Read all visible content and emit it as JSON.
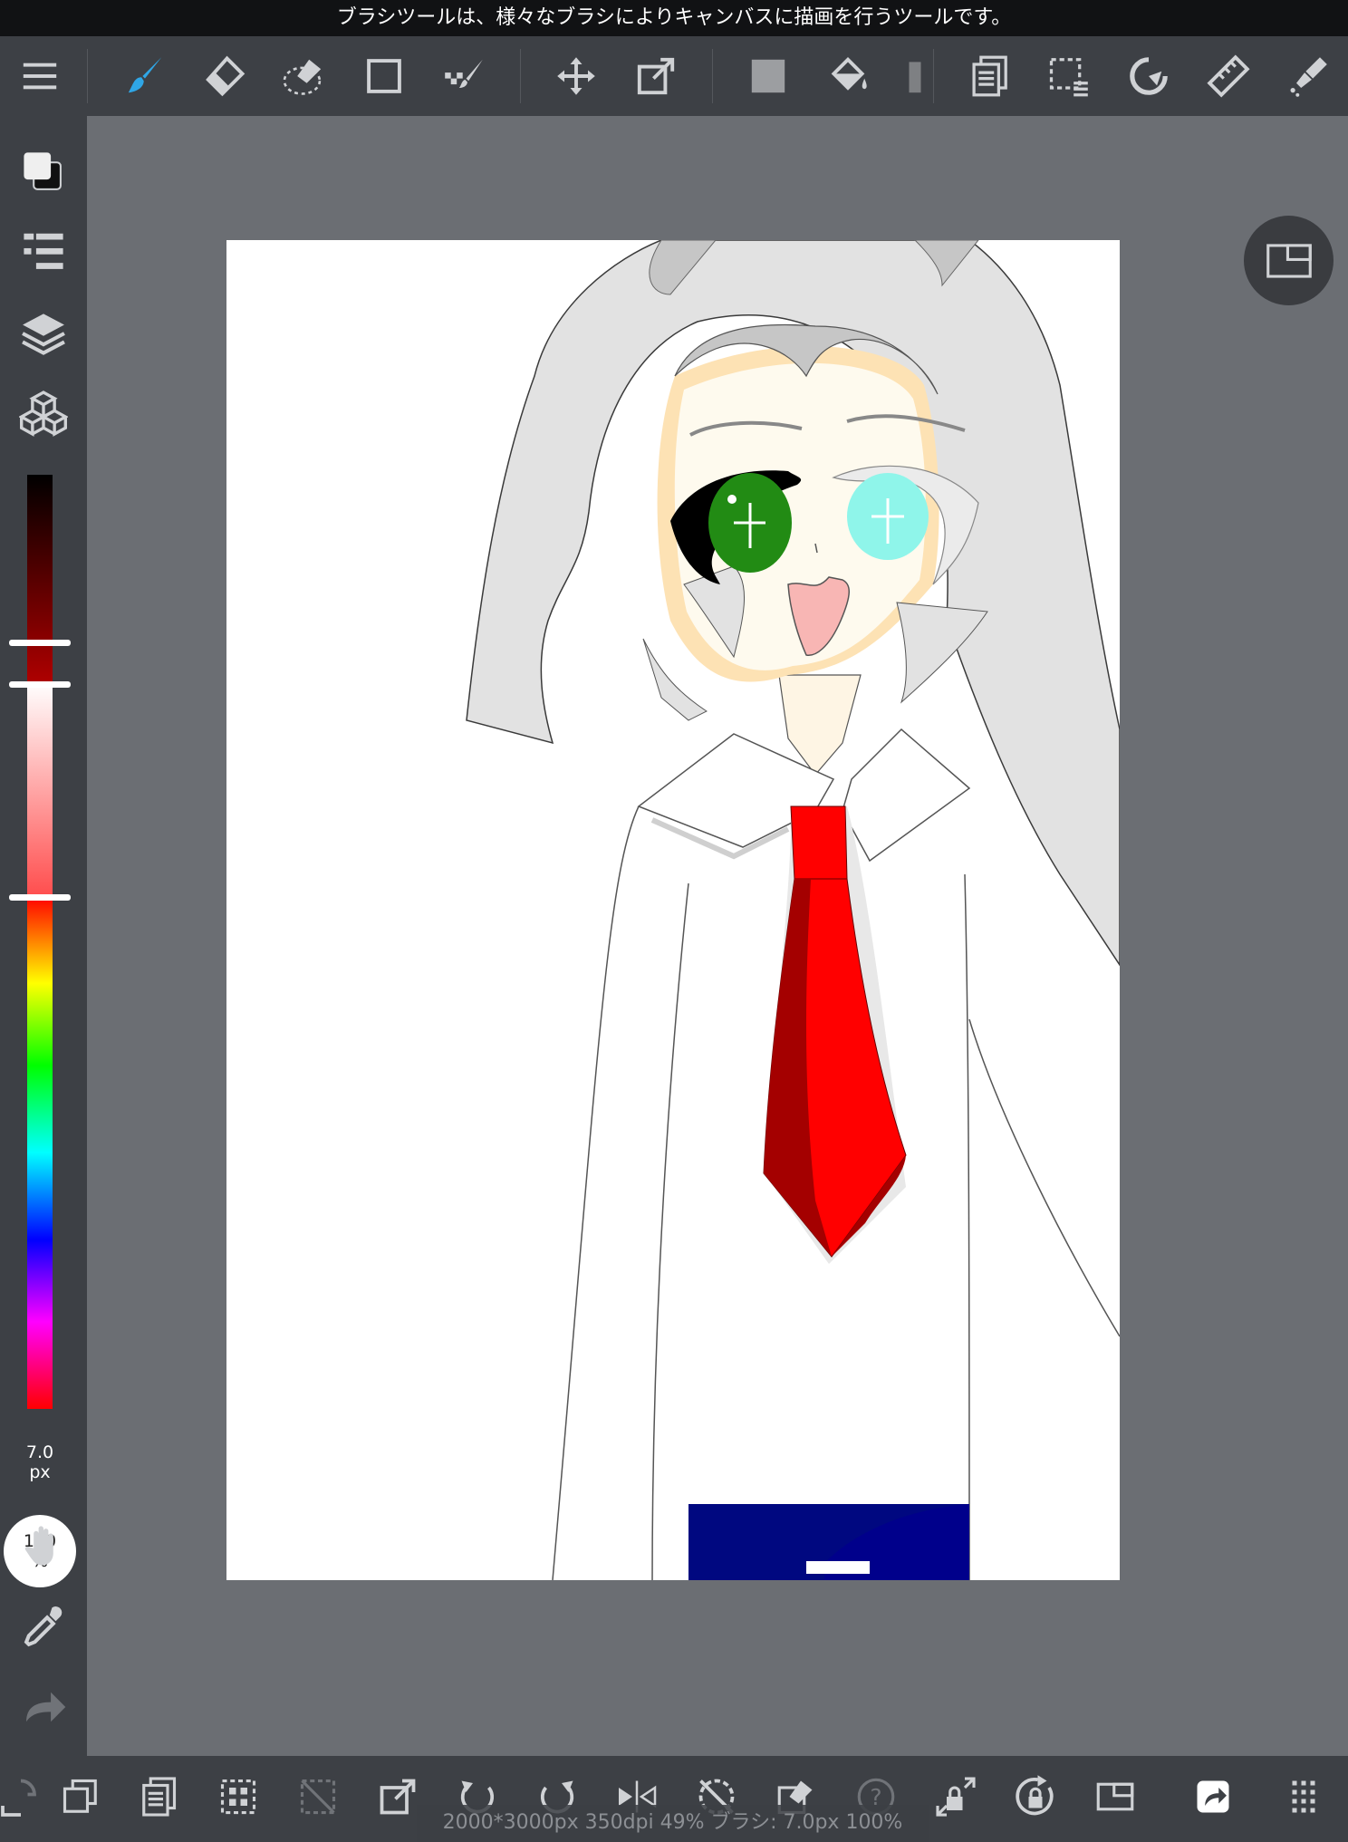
{
  "hint": {
    "text": "ブラシツールは、様々なブラシによりキャンバスに描画を行うツールです。"
  },
  "toolbar": {
    "items": [
      {
        "icon": "menu-icon"
      },
      {
        "icon": "brush-icon",
        "active": true
      },
      {
        "icon": "eraser-icon"
      },
      {
        "icon": "blur-eraser-icon"
      },
      {
        "icon": "shape-rectangle-icon"
      },
      {
        "icon": "dot-brush-icon"
      },
      {
        "icon": "move-icon"
      },
      {
        "icon": "transform-icon"
      },
      {
        "icon": "fill-rect-icon"
      },
      {
        "icon": "bucket-icon"
      },
      {
        "icon": "gradient-icon"
      },
      {
        "icon": "copy-paste-icon"
      },
      {
        "icon": "select-rect-icon"
      },
      {
        "icon": "lasso-icon"
      },
      {
        "icon": "ruler-icon"
      },
      {
        "icon": "auto-select-icon"
      }
    ]
  },
  "sidebar": {
    "brush_size": {
      "value": "7.0",
      "unit": "px"
    },
    "opacity": {
      "value": "100",
      "unit": "%"
    }
  },
  "colors": {
    "accent": "#2fa6e6",
    "primary_color": "#ff0000",
    "panel_bg": "#3d4045",
    "workspace_bg": "#6b6e73"
  },
  "status": {
    "text": "2000*3000px 350dpi 49% ブラシ: 7.0px 100%"
  }
}
